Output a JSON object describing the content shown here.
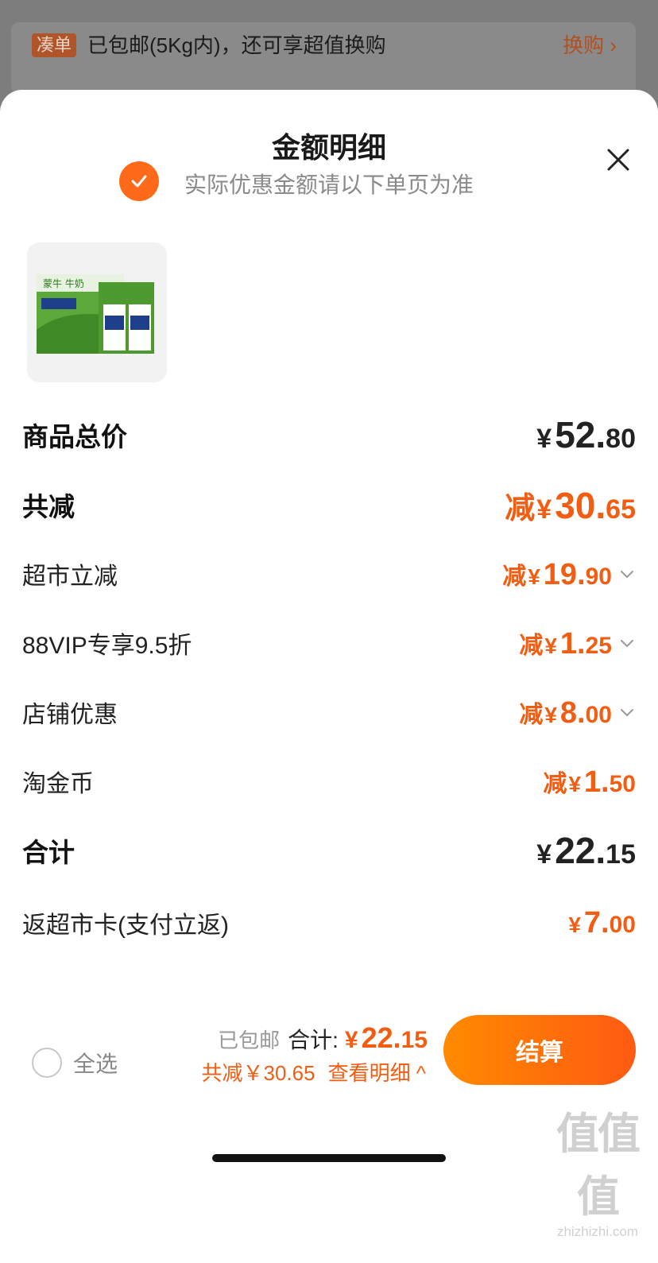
{
  "promo": {
    "tag": "凑单",
    "text": "已包邮(5Kg内)，还可享超值换购",
    "link": "换购 ›"
  },
  "sheet": {
    "title": "金额明细",
    "subtitle": "实际优惠金额请以下单页为准",
    "product_brand_text": "蒙牛 牛奶"
  },
  "rows": [
    {
      "label": "商品总价",
      "prefix": "",
      "yen": "¥",
      "int": "52.",
      "dec": "80",
      "expandable": false
    },
    {
      "label": "共减",
      "prefix": "减",
      "yen": "¥",
      "int": "30.",
      "dec": "65",
      "expandable": false
    },
    {
      "label": "超市立减",
      "prefix": "减",
      "yen": "¥",
      "int": "19.",
      "dec": "90",
      "expandable": true
    },
    {
      "label": "88VIP专享9.5折",
      "prefix": "减",
      "yen": "¥",
      "int": "1.",
      "dec": "25",
      "expandable": true
    },
    {
      "label": "店铺优惠",
      "prefix": "减",
      "yen": "¥",
      "int": "8.",
      "dec": "00",
      "expandable": true
    },
    {
      "label": "淘金币",
      "prefix": "减",
      "yen": "¥",
      "int": "1.",
      "dec": "50",
      "expandable": false
    },
    {
      "label": "合计",
      "prefix": "",
      "yen": "¥",
      "int": "22.",
      "dec": "15",
      "expandable": false
    },
    {
      "label": "返超市卡(支付立返)",
      "prefix": "",
      "yen": "¥",
      "int": "7.",
      "dec": "00",
      "expandable": false
    }
  ],
  "footer": {
    "select_all": "全选",
    "shipping": "已包邮",
    "total_label": "合计:",
    "total_yen": "¥",
    "total_int": "22.",
    "total_dec": "15",
    "discount_text": "共减￥30.65",
    "view_detail": "查看明细 ^",
    "checkout": "结算"
  },
  "watermark": {
    "big": "值值值",
    "small": "zhizhizhi.com"
  },
  "colors": {
    "accent": "#f25d12",
    "checkout_start": "#ff8a00",
    "checkout_end": "#ff5a12"
  }
}
